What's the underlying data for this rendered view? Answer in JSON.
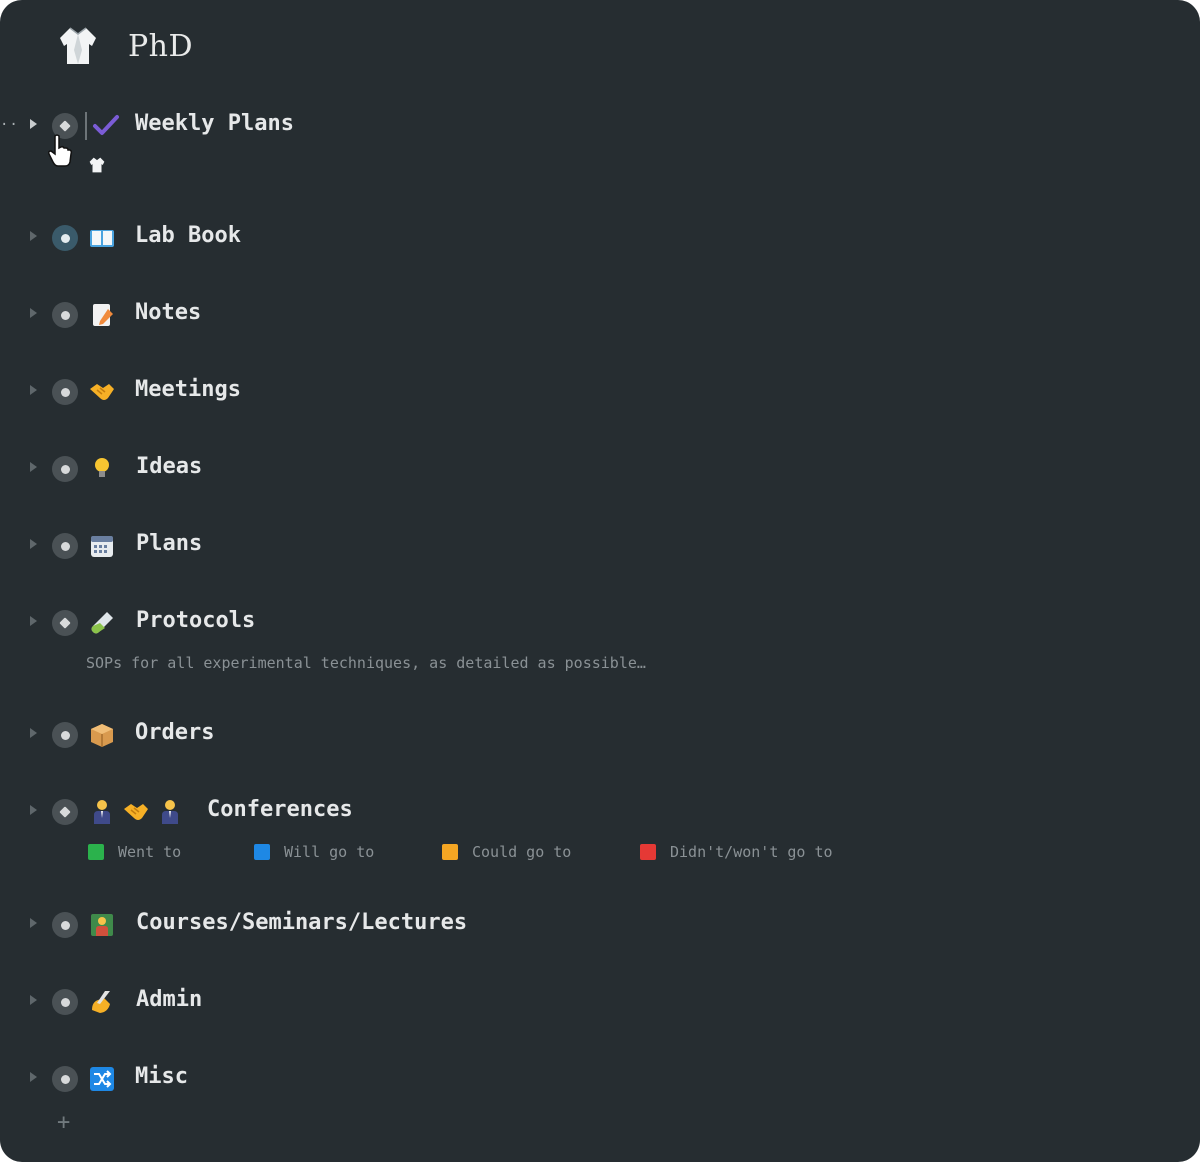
{
  "page": {
    "title": "PhD",
    "icon": "lab-coat-icon"
  },
  "items": [
    {
      "label": "Weekly Plans",
      "icons": [
        "check-mark-icon"
      ]
    },
    {
      "label": "Lab Book",
      "icons": [
        "open-book-icon"
      ]
    },
    {
      "label": "Notes",
      "icons": [
        "memo-icon"
      ]
    },
    {
      "label": "Meetings",
      "icons": [
        "handshake-icon"
      ]
    },
    {
      "label": "Ideas",
      "icons": [
        "light-bulb-icon"
      ]
    },
    {
      "label": "Plans",
      "icons": [
        "calendar-icon"
      ]
    },
    {
      "label": "Protocols",
      "icons": [
        "test-tube-icon"
      ],
      "description": "SOPs for all experimental techniques, as detailed as possible…"
    },
    {
      "label": "Orders",
      "icons": [
        "package-icon"
      ]
    },
    {
      "label": "Conferences",
      "icons": [
        "person-in-suit-icon",
        "handshake-icon",
        "person-in-suit-icon"
      ]
    },
    {
      "label": "Courses/Seminars/Lectures",
      "icons": [
        "teacher-icon"
      ]
    },
    {
      "label": "Admin",
      "icons": [
        "writing-hand-icon"
      ]
    },
    {
      "label": "Misc",
      "icons": [
        "shuffle-icon"
      ]
    }
  ],
  "legend": [
    {
      "label": "Went to",
      "color": "#2bb24c"
    },
    {
      "label": "Will go to",
      "color": "#1e88e5"
    },
    {
      "label": "Could go to",
      "color": "#f5a623"
    },
    {
      "label": "Didn't/won't go to",
      "color": "#e53935"
    }
  ],
  "add_button": "+"
}
